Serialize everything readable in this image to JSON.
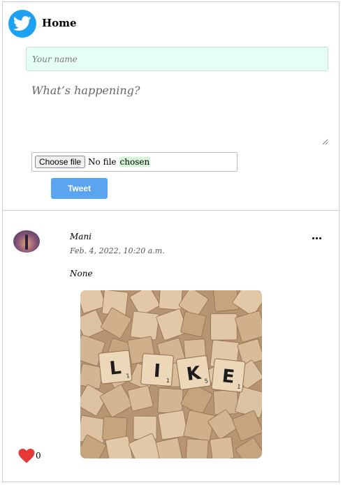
{
  "header": {
    "title": "Home",
    "logo_icon": "twitter-bird-icon"
  },
  "compose": {
    "name_placeholder": "Your name",
    "name_value": "",
    "text_placeholder": "What’s happening?",
    "text_value": "",
    "file_button_label": "Choose file",
    "file_status_part1": "No file",
    "file_status_part2": "chosen",
    "submit_label": "Tweet"
  },
  "post": {
    "author": "Mani",
    "timestamp": "Feb. 4, 2022, 10:20 a.m.",
    "body": "None",
    "image_alt": "scrabble-tiles-spelling-like",
    "image_tiles": [
      "L",
      "I",
      "K",
      "E"
    ],
    "tile_scores": [
      "1",
      "1",
      "5",
      "1"
    ],
    "menu_icon": "more-horizontal-icon",
    "like_icon": "heart-icon",
    "likes": "0"
  },
  "colors": {
    "brand": "#1da1f2",
    "button": "#5ba4ef",
    "name_field_bg": "#e6fff6",
    "heart": "#e53935"
  }
}
